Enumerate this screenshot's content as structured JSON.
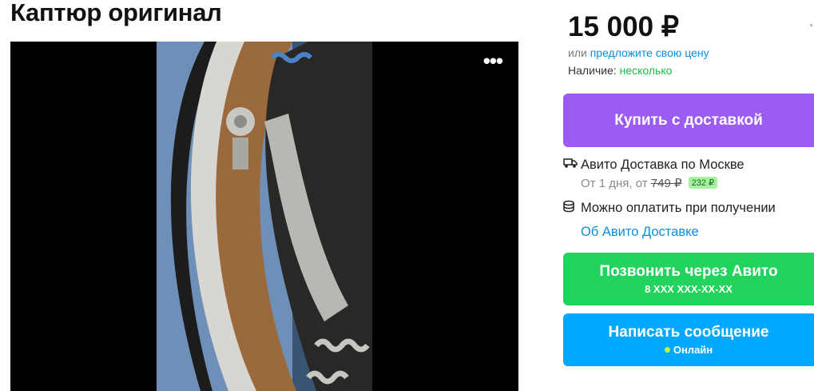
{
  "listing": {
    "title": "Каптюр оригинал"
  },
  "gallery": {
    "more_label": "•••"
  },
  "sidebar": {
    "price": "15 000 ₽",
    "offer_prefix": "или",
    "offer_link": "предложите свою цену",
    "availability_label": "Наличие:",
    "availability_value": "несколько",
    "buy_button": "Купить с доставкой",
    "delivery_title": "Авито Доставка по Москве",
    "delivery_days": "От 1 дня, от",
    "delivery_old_price": "749 ₽",
    "delivery_new_price": "232 ₽",
    "pay_on_receipt": "Можно оплатить при получении",
    "about_delivery_link": "Об Авито Доставке",
    "call_button": "Позвонить через Авито",
    "phone_masked": "8 XXX XXX-XX-XX",
    "message_button": "Написать сообщение",
    "online_status": "Онлайн"
  },
  "colors": {
    "buy": "#9c5cf2",
    "call": "#22d35e",
    "message": "#00a9ff",
    "link": "#0a8fdf",
    "available": "#1eb849"
  }
}
